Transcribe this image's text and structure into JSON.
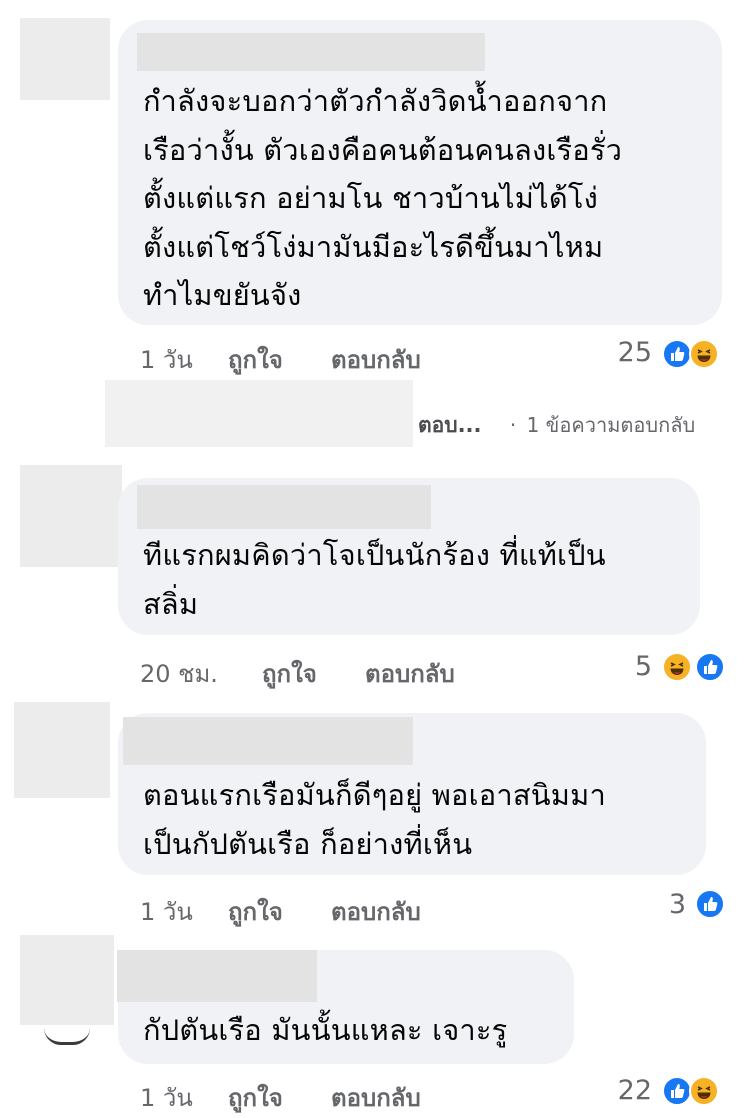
{
  "comments": [
    {
      "text": "กำลังจะบอกว่าตัวกำลังวิดน้ำออกจาก\nเรือว่างั้น  ตัวเองคือคนต้อนคนลงเรือรั่ว\nตั้งแต่แรก  อย่ามโน  ชาวบ้านไม่ได้โง่\nตั้งแต่โชว์โง่มามันมีอะไรดีขึ้นมาไหม\nทำไมขยันจัง",
      "time": "1 วัน",
      "like_label": "ถูกใจ",
      "reply_label": "ตอบกลับ",
      "reaction_count": "25",
      "reactions": [
        "like-icon",
        "haha-icon"
      ]
    },
    {
      "text": "ทีแรกผมคิดว่าโจเป็นนักร้อง  ที่แท้เป็น\nสลิ่ม",
      "time": "20 ชม.",
      "like_label": "ถูกใจ",
      "reply_label": "ตอบกลับ",
      "reaction_count": "5",
      "reactions": [
        "haha-icon",
        "like-icon"
      ]
    },
    {
      "text": "ตอนแรกเรือมันก็ดีๆอยู่  พอเอาสนิมมา\nเป็นกัปตันเรือ  ก็อย่างที่เห็น",
      "time": "1 วัน",
      "like_label": "ถูกใจ",
      "reply_label": "ตอบกลับ",
      "reaction_count": "3",
      "reactions": [
        "like-icon"
      ]
    },
    {
      "text": "กัปตันเรือ  มันนั้นแหละ  เจาะรู",
      "time": "1 วัน",
      "like_label": "ถูกใจ",
      "reply_label": "ตอบกลับ",
      "reaction_count": "22",
      "reactions": [
        "like-icon",
        "haha-icon"
      ]
    }
  ],
  "reply_preview": {
    "truncated_text": "ตอบ...",
    "separator": "·",
    "count_label": "1 ข้อความตอบกลับ"
  },
  "colors": {
    "bubble": "#f0f2f5",
    "meta_text": "#65676b",
    "like_blue": "#1877f2",
    "haha_yellow": "#f7b125"
  }
}
